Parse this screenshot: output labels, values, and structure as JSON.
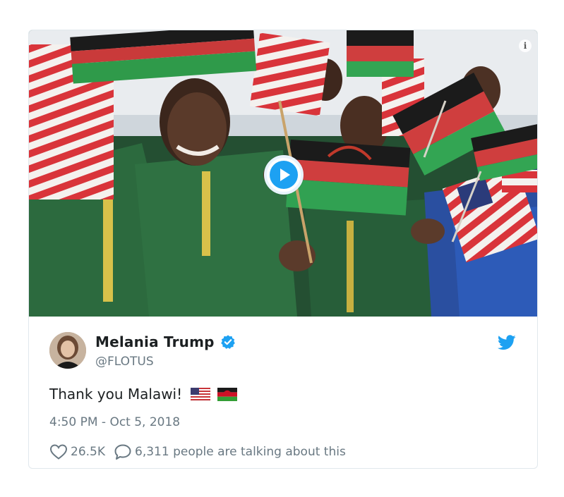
{
  "tweet": {
    "display_name": "Melania Trump",
    "handle": "@FLOTUS",
    "text": "Thank you Malawi!",
    "emoji": [
      "us-flag-emoji",
      "malawi-flag-emoji"
    ],
    "timestamp": "4:50 PM - Oct 5, 2018",
    "likes": "26.5K",
    "talking": "6,311 people are talking about this"
  },
  "media": {
    "type": "video",
    "info_label": "i"
  },
  "colors": {
    "twitter_blue": "#1da1f2",
    "secondary_text": "#697882",
    "border": "#e1e8ed"
  }
}
